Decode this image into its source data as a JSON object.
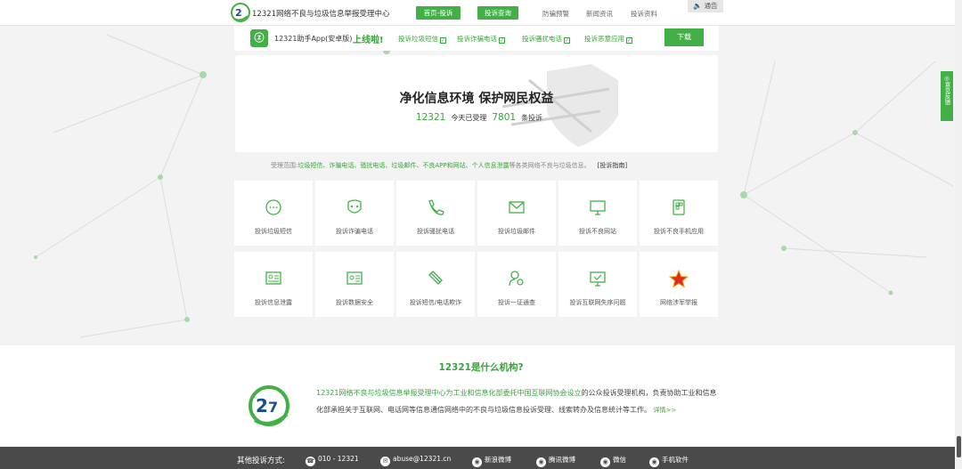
{
  "header": {
    "site_title": "12321网络不良与垃圾信息举报受理中心",
    "nav": [
      "首页-投诉",
      "投诉查询",
      "防骗预警",
      "新闻资讯",
      "投诉资料"
    ],
    "notice": "通告"
  },
  "app_bar": {
    "text": "12321助手App(安卓版)",
    "online": "上线啦!",
    "features": [
      "投诉垃圾短信",
      "投诉诈骗电话",
      "投诉骚扰电话",
      "投诉恶意应用"
    ],
    "download": "下载"
  },
  "hero": {
    "title": "净化信息环境 保护网民权益",
    "brand": "12321",
    "stat_prefix": "今天已受理",
    "count": "7801",
    "stat_suffix": "条投诉"
  },
  "scope": {
    "label": "受理范围:",
    "items": "垃圾短信、诈骗电话、骚扰电话、垃圾邮件、不良APP和网站、个人信息泄露",
    "suffix": "等各类网络不良与垃圾信息。",
    "guide": "[投诉指南]"
  },
  "tiles": [
    {
      "label": "投诉垃圾短信",
      "icon": "chat-icon"
    },
    {
      "label": "投诉诈骗电话",
      "icon": "mask-icon"
    },
    {
      "label": "投诉骚扰电话",
      "icon": "phone-icon"
    },
    {
      "label": "投诉垃圾邮件",
      "icon": "mail-icon"
    },
    {
      "label": "投诉不良网站",
      "icon": "monitor-icon"
    },
    {
      "label": "投诉不良手机应用",
      "icon": "mobile-app-icon"
    },
    {
      "label": "投诉信息泄露",
      "icon": "id-card-icon"
    },
    {
      "label": "投诉数据安全",
      "icon": "data-card-icon"
    },
    {
      "label": "投诉短信/电话欺诈",
      "icon": "fraud-icon"
    },
    {
      "label": "投诉一证通查",
      "icon": "user-search-icon"
    },
    {
      "label": "投诉互联网失序问题",
      "icon": "monitor-check-icon"
    },
    {
      "label": "网络涉军举报",
      "icon": "army-star-icon"
    }
  ],
  "side_feedback": "意见反馈",
  "about": {
    "title": "12321是什么机构?",
    "lead": "12321网络不良与垃圾信息举报受理中心为",
    "link": "工业和信息化部委托中国互联网协会设立",
    "body": "的公众投诉受理机构，负责协助工业和信息化部承担关于互联网、电话网等信息通信网络中的不良与垃圾信息投诉受理、线索转办及信息统计等工作。",
    "more": "详情>>"
  },
  "footer": {
    "label": "其他投诉方式:",
    "items": [
      "010 - 12321",
      "abuse@12321.cn",
      "新浪微博",
      "腾讯微博",
      "微信",
      "手机软件"
    ]
  },
  "colors": {
    "brand_green": "#43b047",
    "footer_bg": "#4a4a4a"
  }
}
